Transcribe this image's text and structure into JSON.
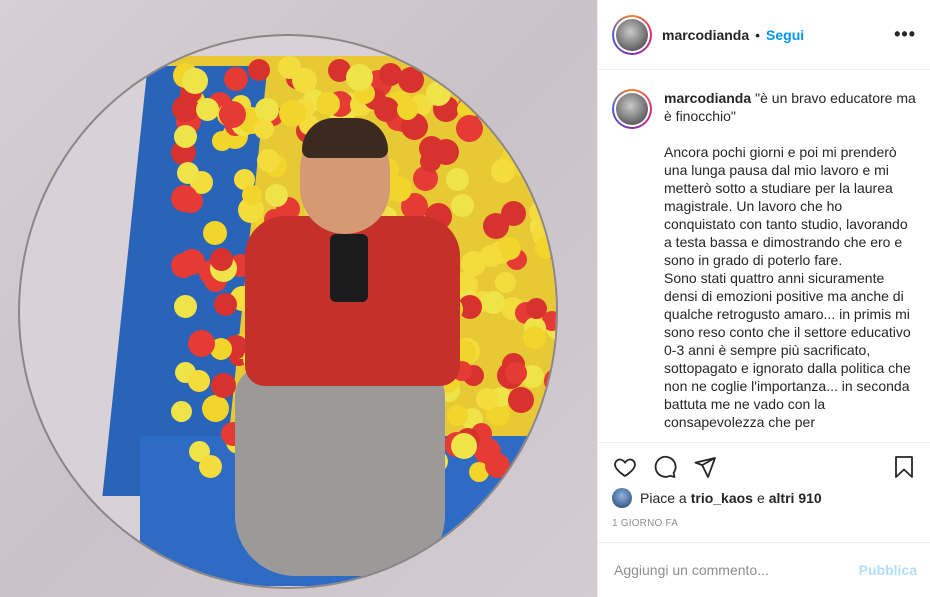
{
  "post": {
    "username": "marcodianda",
    "follow_label": "Segui",
    "separator": "•",
    "more_label": "•••"
  },
  "caption": {
    "username": "marcodianda",
    "title": "\"è un bravo educatore ma è finocchio\"",
    "body": "Ancora pochi giorni e poi mi prenderò una lunga pausa dal mio lavoro e mi metterò sotto a studiare per la laurea magistrale. Un lavoro che ho conquistato con tanto studio, lavorando a testa bassa e dimostrando che ero e sono in grado di poterlo fare.\nSono stati quattro anni sicuramente densi di emozioni positive ma anche di qualche retrogusto amaro... in primis mi sono reso conto che il settore educativo 0-3 anni è sempre più sacrificato, sottopagato e ignorato dalla politica che non ne coglie l'importanza... in seconda battuta me ne vado con la consapevolezza che per"
  },
  "actions": {
    "like_icon": "heart-icon",
    "comment_icon": "comment-icon",
    "share_icon": "paper-plane-icon",
    "save_icon": "bookmark-icon"
  },
  "likes": {
    "prefix": "Piace a",
    "user": "trio_kaos",
    "connector": "e",
    "others": "altri 910"
  },
  "timestamp": "1 GIORNO FA",
  "comment_box": {
    "placeholder": "Aggiungi un commento...",
    "publish_label": "Pubblica"
  },
  "colors": {
    "accent": "#0095f6",
    "publish_disabled": "#b2dffc",
    "muted": "#8e8e8e",
    "border": "#efefef"
  }
}
